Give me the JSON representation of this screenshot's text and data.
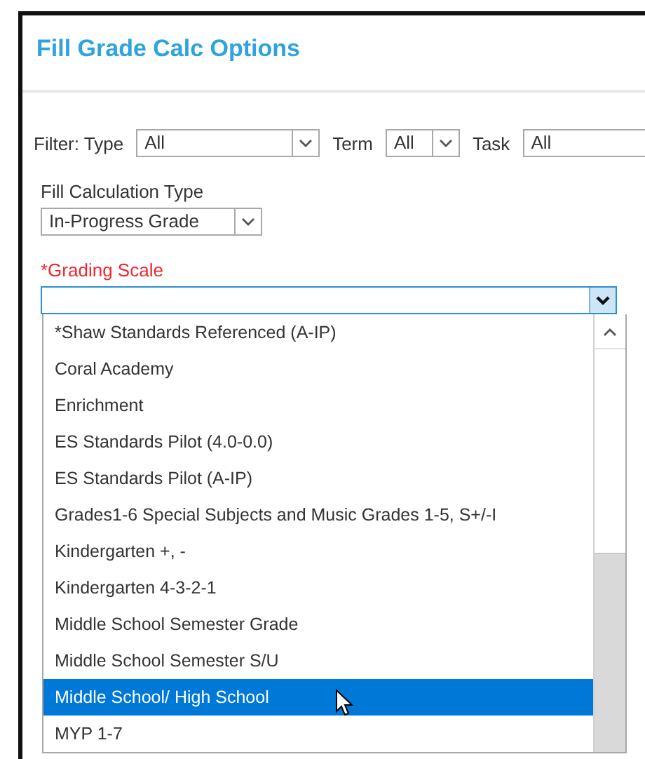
{
  "title": "Fill Grade Calc Options",
  "filter": {
    "type_label": "Filter: Type",
    "type_value": "All",
    "term_label": "Term",
    "term_value": "All",
    "task_label": "Task",
    "task_value": "All"
  },
  "fill_calculation": {
    "label": "Fill Calculation Type",
    "value": "In-Progress Grade"
  },
  "grading_scale": {
    "label": "*Grading Scale",
    "required": true,
    "open": true,
    "options": [
      {
        "label": "*Shaw Standards Referenced (A-IP)",
        "selected": false
      },
      {
        "label": "Coral Academy",
        "selected": false
      },
      {
        "label": "Enrichment",
        "selected": false
      },
      {
        "label": "ES Standards Pilot (4.0-0.0)",
        "selected": false
      },
      {
        "label": "ES Standards Pilot (A-IP)",
        "selected": false
      },
      {
        "label": "Grades1-6 Special Subjects and Music Grades 1-5, S+/-I",
        "selected": false
      },
      {
        "label": "Kindergarten +, -",
        "selected": false
      },
      {
        "label": "Kindergarten 4-3-2-1",
        "selected": false
      },
      {
        "label": "Middle School Semester Grade",
        "selected": false
      },
      {
        "label": "Middle School Semester S/U",
        "selected": false
      },
      {
        "label": "Middle School/ High School",
        "selected": true
      },
      {
        "label": "MYP 1-7",
        "selected": false
      }
    ]
  }
}
